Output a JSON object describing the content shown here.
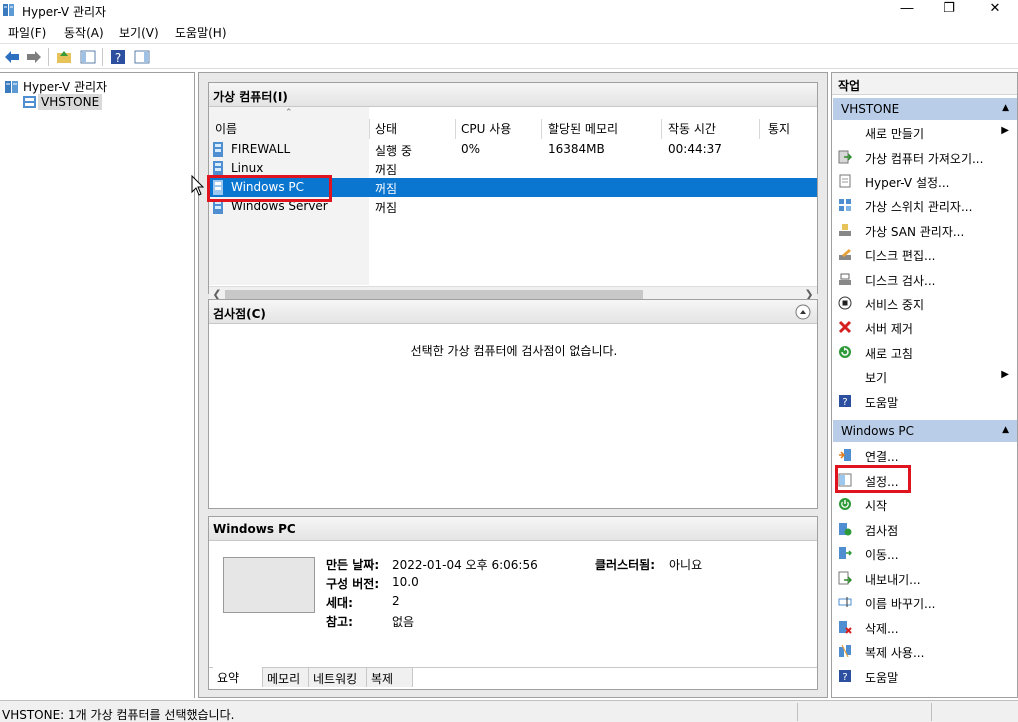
{
  "window": {
    "title": "Hyper-V 관리자"
  },
  "menubar": [
    "파일(F)",
    "동작(A)",
    "보기(V)",
    "도움말(H)"
  ],
  "tree": {
    "root": "Hyper-V 관리자",
    "server": "VHSTONE"
  },
  "vm_panel": {
    "title": "가상 컴퓨터(I)",
    "columns": [
      "이름",
      "상태",
      "CPU 사용",
      "할당된 메모리",
      "작동 시간",
      "통지"
    ],
    "rows": [
      {
        "name": "FIREWALL",
        "state": "실행 중",
        "cpu": "0%",
        "memory": "16384MB",
        "uptime": "00:44:37"
      },
      {
        "name": "Linux",
        "state": "꺼짐",
        "cpu": "",
        "memory": "",
        "uptime": ""
      },
      {
        "name": "Windows PC",
        "state": "꺼짐",
        "cpu": "",
        "memory": "",
        "uptime": ""
      },
      {
        "name": "Windows Server",
        "state": "꺼짐",
        "cpu": "",
        "memory": "",
        "uptime": ""
      }
    ]
  },
  "checkpoint_panel": {
    "title": "검사점(C)",
    "empty_message": "선택한 가상 컴퓨터에 검사점이 없습니다."
  },
  "details_panel": {
    "title": "Windows PC",
    "created_label": "만든 날짜:",
    "created_value": "2022-01-04 오후 6:06:56",
    "clustered_label": "클러스터됨:",
    "clustered_value": "아니요",
    "config_label": "구성 버전:",
    "config_value": "10.0",
    "gen_label": "세대:",
    "gen_value": "2",
    "notes_label": "참고:",
    "notes_value": "없음",
    "tabs": [
      "요약",
      "메모리",
      "네트워킹",
      "복제"
    ]
  },
  "actions": {
    "title": "작업",
    "server_section": "VHSTONE",
    "server_items": [
      "새로 만들기",
      "가상 컴퓨터 가져오기...",
      "Hyper-V 설정...",
      "가상 스위치 관리자...",
      "가상 SAN 관리자...",
      "디스크 편집...",
      "디스크 검사...",
      "서비스 중지",
      "서버 제거",
      "새로 고침",
      "보기",
      "도움말"
    ],
    "vm_section": "Windows PC",
    "vm_items": [
      "연결...",
      "설정...",
      "시작",
      "검사점",
      "이동...",
      "내보내기...",
      "이름 바꾸기...",
      "삭제...",
      "복제 사용...",
      "도움말"
    ]
  },
  "status": {
    "text": "VHSTONE:  1개 가상 컴퓨터를 선택했습니다."
  },
  "colors": {
    "selection": "#0a76d0",
    "section": "#b9cde8",
    "highlight_box": "#e0141e"
  }
}
